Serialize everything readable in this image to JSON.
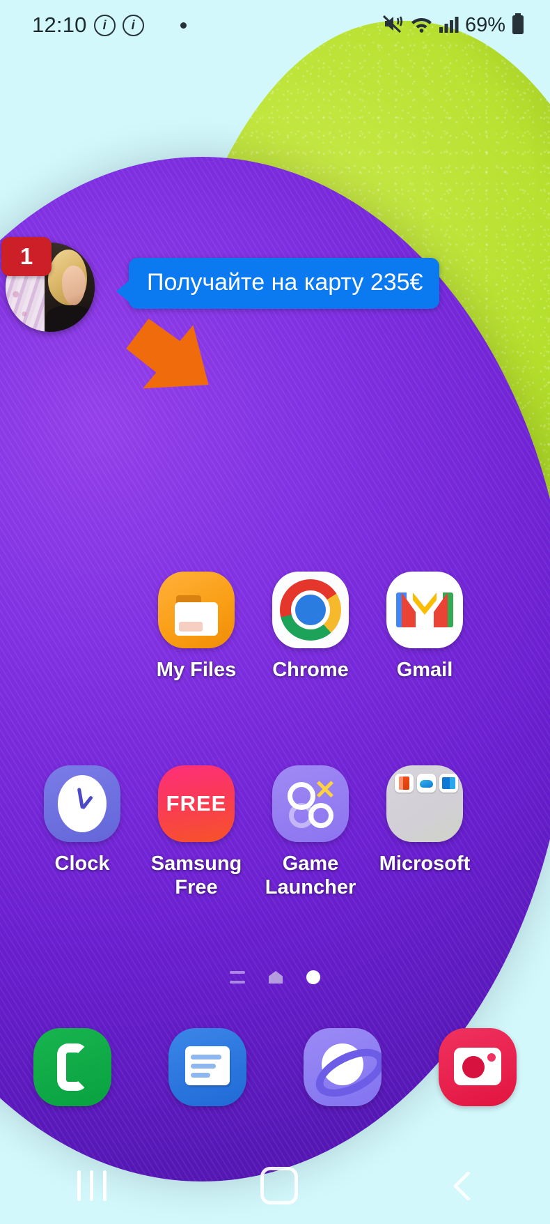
{
  "statusbar": {
    "time": "12:10",
    "info_icon_1": "info-circle-icon",
    "info_icon_2": "info-circle-icon",
    "notification_dot": "notification-dot",
    "mute_icon": "vibrate-mute-icon",
    "wifi_icon": "wifi-icon",
    "signal_icon": "cellular-signal-icon",
    "battery_percent": "69%",
    "battery_icon": "battery-icon"
  },
  "chathead": {
    "badge_count": "1",
    "avatar_name": "contact-avatar",
    "bubble_text": "Получайте на карту 235€",
    "bubble_color": "#0b79ef",
    "badge_color": "#cc1f28",
    "arrow_color": "#ef6b0c"
  },
  "apps": {
    "row1": [
      {
        "label": "My Files",
        "icon": "my-files-icon"
      },
      {
        "label": "Chrome",
        "icon": "chrome-icon"
      },
      {
        "label": "Gmail",
        "icon": "gmail-icon"
      }
    ],
    "row2": [
      {
        "label": "Clock",
        "icon": "clock-icon"
      },
      {
        "label": "Samsung Free",
        "icon": "samsung-free-icon",
        "icon_text": "FREE"
      },
      {
        "label": "Game Launcher",
        "icon": "game-launcher-icon"
      },
      {
        "label": "Microsoft",
        "icon": "microsoft-folder-icon",
        "folder_items": [
          "office-icon",
          "onedrive-icon",
          "outlook-icon"
        ]
      }
    ]
  },
  "page_indicator": {
    "items": [
      "app-list-indicator",
      "home-indicator",
      "current-page-dot"
    ],
    "current_index": 2
  },
  "dock": [
    {
      "label": "Phone",
      "icon": "phone-icon"
    },
    {
      "label": "Messages",
      "icon": "messages-icon"
    },
    {
      "label": "Internet",
      "icon": "samsung-internet-icon"
    },
    {
      "label": "Camera",
      "icon": "camera-icon"
    }
  ],
  "navbar": [
    {
      "label": "Recents",
      "icon": "recents-icon"
    },
    {
      "label": "Home",
      "icon": "home-icon"
    },
    {
      "label": "Back",
      "icon": "back-icon"
    }
  ],
  "wallpaper": {
    "watermark_text": "",
    "background_color": "#d2f8fc",
    "purple_color": "#6a1fd0",
    "green_color": "#b5df2c"
  }
}
